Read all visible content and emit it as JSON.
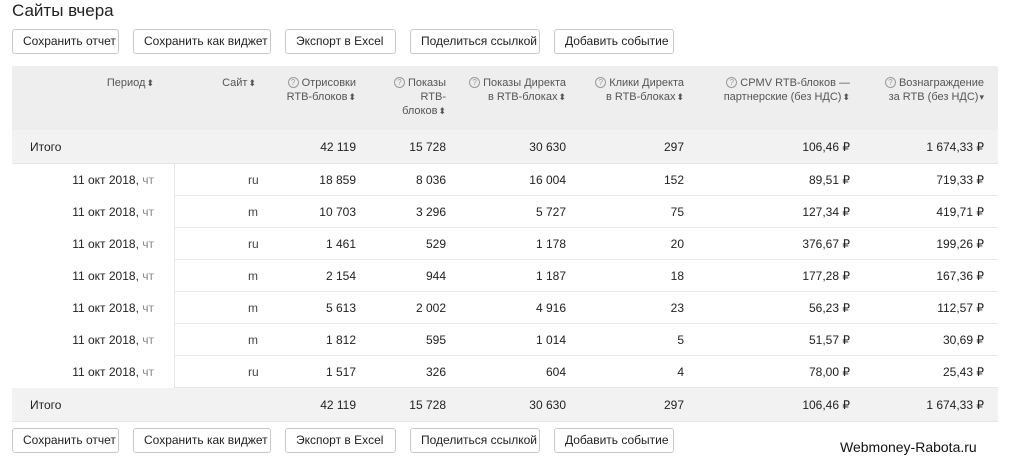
{
  "page": {
    "title": "Сайты вчера"
  },
  "toolbar": {
    "buttons": [
      "Сохранить отчет",
      "Сохранить как виджет",
      "Экспорт в Excel",
      "Поделиться ссылкой",
      "Добавить событие"
    ]
  },
  "table": {
    "headers": {
      "period": "Период",
      "site": "Сайт",
      "m1": [
        "Отрисовки",
        "RTB-блоков"
      ],
      "m2": [
        "Показы",
        "RTB-",
        "блоков"
      ],
      "m3": [
        "Показы Директа",
        "в RTB-блоках"
      ],
      "m4": [
        "Клики Директа",
        "в RTB-блоках"
      ],
      "m5": [
        "CPMV RTB-блоков —",
        "партнерские (без НДС)"
      ],
      "m6": [
        "Вознаграждение",
        "за RTB (без НДС)"
      ]
    },
    "total_label": "Итого",
    "totals": [
      "42 119",
      "15 728",
      "30 630",
      "297",
      "106,46 ₽",
      "1 674,33 ₽"
    ],
    "rows": [
      {
        "date": "11 окт 2018,",
        "dow": "чт",
        "site": "ru",
        "vals": [
          "18 859",
          "8 036",
          "16 004",
          "152",
          "89,51 ₽",
          "719,33 ₽"
        ]
      },
      {
        "date": "11 окт 2018,",
        "dow": "чт",
        "site": "m",
        "vals": [
          "10 703",
          "3 296",
          "5 727",
          "75",
          "127,34 ₽",
          "419,71 ₽"
        ]
      },
      {
        "date": "11 окт 2018,",
        "dow": "чт",
        "site": "ru",
        "vals": [
          "1 461",
          "529",
          "1 178",
          "20",
          "376,67 ₽",
          "199,26 ₽"
        ]
      },
      {
        "date": "11 окт 2018,",
        "dow": "чт",
        "site": "m",
        "vals": [
          "2 154",
          "944",
          "1 187",
          "18",
          "177,28 ₽",
          "167,36 ₽"
        ]
      },
      {
        "date": "11 окт 2018,",
        "dow": "чт",
        "site": "m",
        "vals": [
          "5 613",
          "2 002",
          "4 916",
          "23",
          "56,23 ₽",
          "112,57 ₽"
        ]
      },
      {
        "date": "11 окт 2018,",
        "dow": "чт",
        "site": "m",
        "vals": [
          "1 812",
          "595",
          "1 014",
          "5",
          "51,57 ₽",
          "30,69 ₽"
        ]
      },
      {
        "date": "11 окт 2018,",
        "dow": "чт",
        "site": "ru",
        "vals": [
          "1 517",
          "326",
          "604",
          "4",
          "78,00 ₽",
          "25,43 ₽"
        ]
      }
    ]
  },
  "watermark": "Webmoney-Rabota.ru"
}
